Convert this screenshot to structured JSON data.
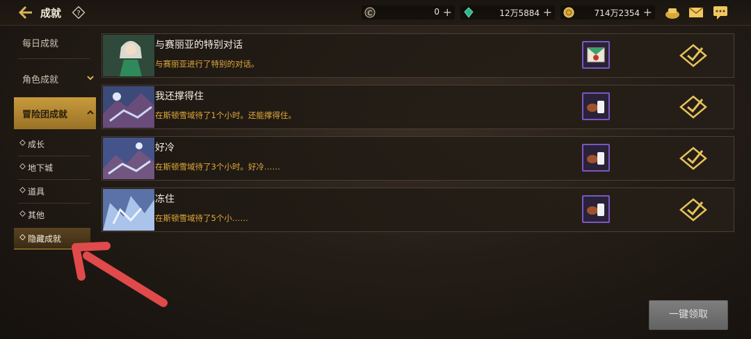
{
  "header": {
    "title": "成就",
    "help_label": "?",
    "currencies": [
      {
        "icon": "coin-c-icon",
        "value": "0"
      },
      {
        "icon": "green-gem-icon",
        "value": "12万5884"
      },
      {
        "icon": "gold-coin-icon",
        "value": "714万2354"
      }
    ],
    "plus_label": "+"
  },
  "sidebar": {
    "daily": "每日成就",
    "character": "角色成就",
    "adventure": "冒险团成就",
    "subs": [
      "成长",
      "地下城",
      "道具",
      "其他",
      "隐藏成就"
    ]
  },
  "achievements": [
    {
      "title": "与赛丽亚的特别对话",
      "desc": "与赛丽亚进行了特别的对话。",
      "thumb": "seria-portrait",
      "reward": "letter-icon"
    },
    {
      "title": "我还撑得住",
      "desc": "在斯顿雪域待了1个小时。还能撑得住。",
      "thumb": "snow-monster",
      "reward": "meat-milk-icon"
    },
    {
      "title": "好冷",
      "desc": "在斯顿雪域待了3个小时。好冷……",
      "thumb": "snow-monster",
      "reward": "meat-milk-icon"
    },
    {
      "title": "冻住",
      "desc": "在斯顿雪域待了5个小……",
      "thumb": "frozen-monster",
      "reward": "meat-milk-icon"
    }
  ],
  "onekey_label": "一键领取",
  "colors": {
    "accent_gold": "#c79a3c",
    "desc_orange": "#e2a93a",
    "reward_border": "#7a57c4",
    "annotation_red": "#e04a4a"
  }
}
